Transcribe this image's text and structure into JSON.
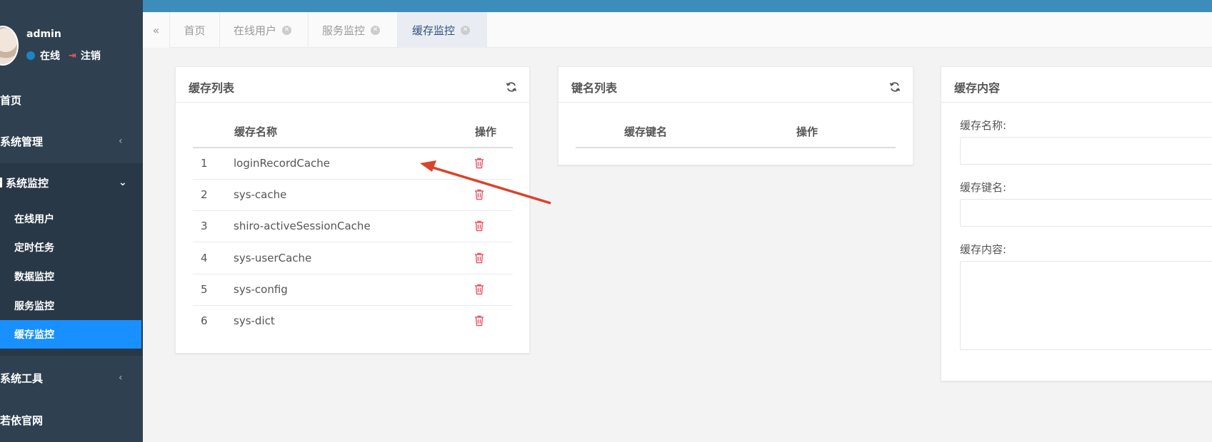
{
  "user": {
    "name": "admin",
    "status": "在线",
    "logout": "注销"
  },
  "sidebar": {
    "items": [
      {
        "label": "首页",
        "chevron": ""
      },
      {
        "label": "系统管理",
        "chevron": "‹"
      },
      {
        "label": "系统监控",
        "chevron": "⌄"
      },
      {
        "label": "系统工具",
        "chevron": "‹"
      },
      {
        "label": "若依官网",
        "chevron": ""
      }
    ],
    "submenu": [
      "在线用户",
      "定时任务",
      "数据监控",
      "服务监控",
      "缓存监控"
    ]
  },
  "tabs": [
    {
      "label": "首页"
    },
    {
      "label": "在线用户"
    },
    {
      "label": "服务监控"
    },
    {
      "label": "缓存监控"
    }
  ],
  "cache_list": {
    "title": "缓存列表",
    "headers": {
      "name": "缓存名称",
      "op": "操作"
    },
    "rows": [
      {
        "index": "1",
        "name": "loginRecordCache"
      },
      {
        "index": "2",
        "name": "sys-cache"
      },
      {
        "index": "3",
        "name": "shiro-activeSessionCache"
      },
      {
        "index": "4",
        "name": "sys-userCache"
      },
      {
        "index": "5",
        "name": "sys-config"
      },
      {
        "index": "6",
        "name": "sys-dict"
      }
    ]
  },
  "key_list": {
    "title": "键名列表",
    "headers": {
      "key": "缓存键名",
      "op": "操作"
    }
  },
  "cache_content": {
    "title": "缓存内容",
    "name_label": "缓存名称:",
    "key_label": "缓存键名:",
    "content_label": "缓存内容:"
  },
  "colors": {
    "sidebar": "#2f4050",
    "active": "#1890ff",
    "topbar": "#3c8dbc",
    "danger": "#ed5565",
    "arrow": "#d9442b"
  }
}
